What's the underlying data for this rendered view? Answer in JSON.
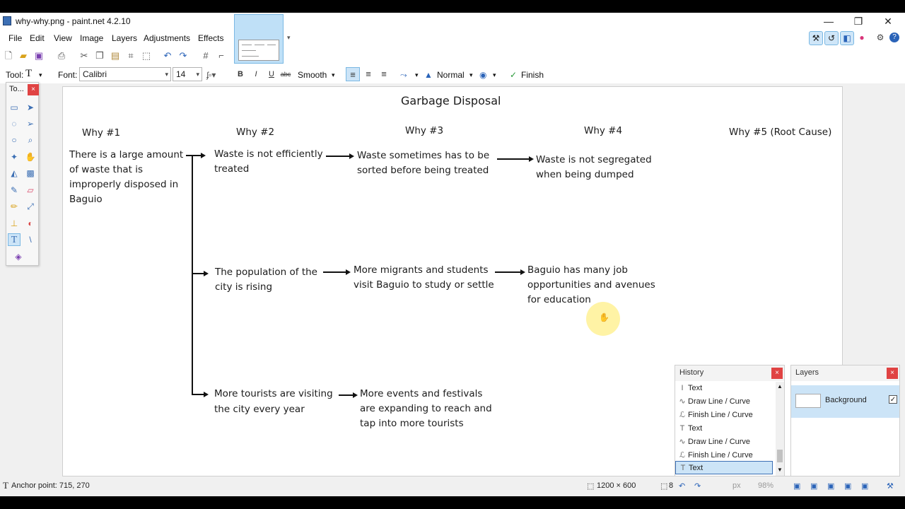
{
  "window": {
    "title": "why-why.png - paint.net 4.2.10"
  },
  "titlebar": {
    "minimize": "—",
    "restore": "❐",
    "close": "✕"
  },
  "menu": [
    "File",
    "Edit",
    "View",
    "Image",
    "Layers",
    "Adjustments",
    "Effects"
  ],
  "toolbar2": {
    "tool_label": "Tool:",
    "font_label": "Font:",
    "font_value": "Calibri",
    "size_value": "14",
    "bold": "B",
    "italic": "I",
    "underline": "U",
    "strike": "abc",
    "antialias": "Smooth",
    "blend": "Normal",
    "finish": "Finish"
  },
  "tools_panel": {
    "title": "To...",
    "close": "×"
  },
  "diagram": {
    "title": "Garbage Disposal",
    "headers": [
      "Why #1",
      "Why #2",
      "Why #3",
      "Why #4",
      "Why #5 (Root Cause)"
    ],
    "why1": [
      "There is a large amount",
      "of waste that is",
      "improperly disposed in",
      "Baguio"
    ],
    "row1": {
      "why2": [
        "Waste is not efficiently",
        "treated"
      ],
      "why3": [
        "Waste sometimes has to be",
        "sorted before being treated"
      ],
      "why4": [
        "Waste is not segregated",
        "when being dumped"
      ]
    },
    "row2": {
      "why2": [
        "The population of the",
        "city is rising"
      ],
      "why3": [
        "More migrants and students",
        "visit Baguio to study or settle"
      ],
      "why4": [
        "Baguio has many job",
        "opportunities and avenues",
        "for education"
      ]
    },
    "row3": {
      "why2": [
        "More tourists are visiting",
        "the city every year"
      ],
      "why3": [
        "More events and festivals",
        "are expanding to reach and",
        "tap into more tourists"
      ]
    }
  },
  "history": {
    "title": "History",
    "close": "×",
    "items": [
      "Text",
      "Draw Line / Curve",
      "Finish Line / Curve",
      "Text",
      "Draw Line / Curve",
      "Finish Line / Curve",
      "Text"
    ]
  },
  "layers": {
    "title": "Layers",
    "close": "×",
    "items": [
      "Background"
    ]
  },
  "status": {
    "anchor": "Anchor point: 715, 270",
    "image_size": "1200 × 600",
    "selection": "8",
    "unit": "px",
    "zoom": "98%"
  }
}
